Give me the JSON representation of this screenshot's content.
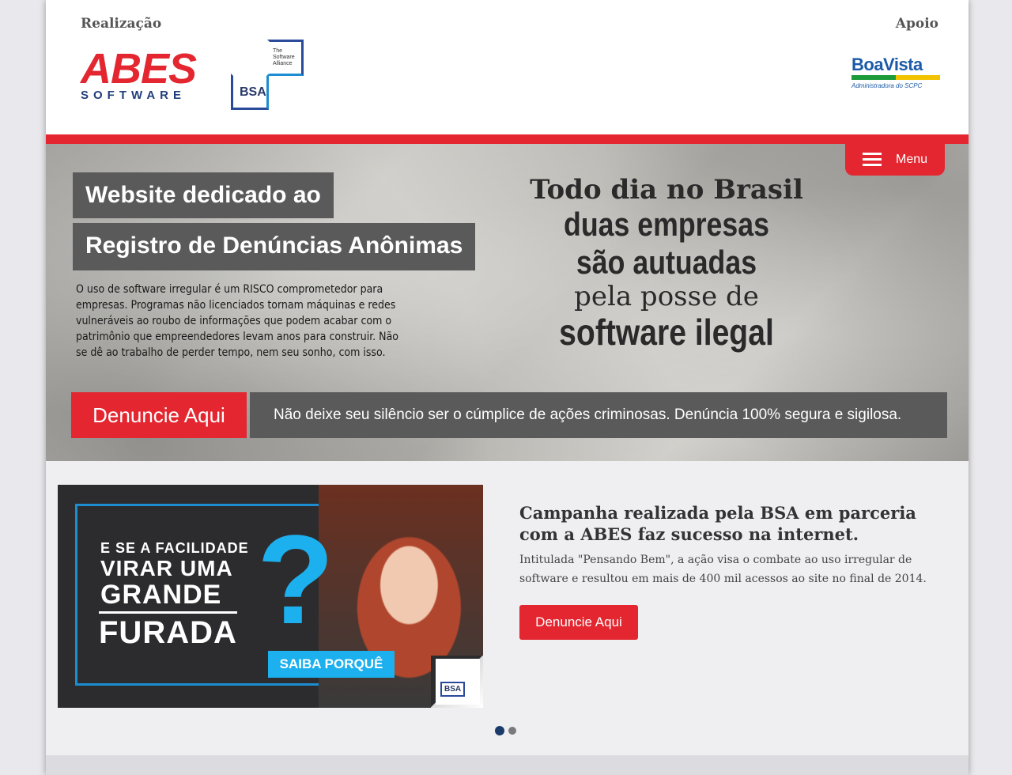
{
  "header": {
    "left_label": "Realização",
    "right_label": "Apoio",
    "abes_logo": {
      "word": "ABES",
      "sub": "SOFTWARE"
    },
    "bsa_logo": {
      "alliance": "The Software Alliance",
      "short": "BSA"
    },
    "boavista_logo": {
      "name": "BoaVista",
      "tagline": "Administradora do SCPC"
    }
  },
  "hero": {
    "menu_label": "Menu",
    "box1": "Website dedicado ao",
    "box2": "Registro de Denúncias Anônimas",
    "paragraph": "O uso de software irregular é um RISCO comprometedor para empresas. Programas não licenciados tornam máquinas e redes vulneráveis ao roubo de informações que podem acabar com o patrimônio que empreendedores levam anos para construir.  Não se dê ao trabalho de perder tempo, nem seu sonho, com isso.",
    "slogan": {
      "line1": "Todo dia no Brasil",
      "line2": "duas empresas",
      "line3": "são autuadas",
      "line4": "pela posse de",
      "line5": "software ilegal"
    },
    "cta_label": "Denuncie Aqui",
    "cta_message": "Não deixe seu silêncio ser o cúmplice de ações criminosas. Denúncia 100% segura e sigilosa."
  },
  "slider": {
    "promo": {
      "line1": "E SE A FACILIDADE",
      "line2": "VIRAR UMA",
      "line3": "GRANDE",
      "line4": "FURADA",
      "qmark": "?",
      "button": "SAIBA PORQUÊ",
      "bsa": "BSA"
    },
    "title": "Campanha realizada pela BSA em parceria com a ABES faz sucesso na internet.",
    "body": "Intitulada \"Pensando Bem\", a ação visa o combate ao uso irregular de software e resultou em mais de 400 mil acessos ao site no final de 2014.",
    "button_label": "Denuncie Aqui",
    "dots_total": 2,
    "active_dot": 1
  },
  "colors": {
    "accent_red": "#e3262f",
    "dark_box": "#5a5a5a",
    "promo_blue": "#1cb0ee",
    "dot_active": "#1a3a6a"
  },
  "icons": [
    "hamburger-menu-icon"
  ]
}
